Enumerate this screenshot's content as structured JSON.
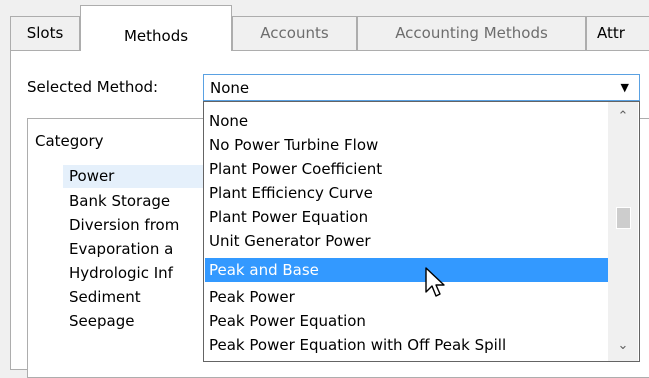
{
  "tabs": [
    "Slots",
    "Methods",
    "Accounts",
    "Accounting Methods",
    "Attr"
  ],
  "selected_method": {
    "label": "Selected Method:",
    "value": "None"
  },
  "category": {
    "header": "Category",
    "items": [
      "Power",
      "Bank Storage",
      "Diversion from",
      "Evaporation a",
      "Hydrologic Inf",
      "Sediment",
      "Seepage"
    ]
  },
  "dropdown": {
    "options": [
      "None",
      "No Power Turbine Flow",
      "Plant Power Coefficient",
      "Plant Efficiency Curve",
      "Plant Power Equation",
      "Unit Generator Power",
      "Peak and Base",
      "Peak Power",
      "Peak Power Equation",
      "Peak Power Equation with Off Peak Spill"
    ],
    "highlighted": "Peak and Base"
  },
  "colors": {
    "selection": "#3399ff",
    "focus_border": "#5aa1e2",
    "window_bg": "#f0f0f0"
  }
}
